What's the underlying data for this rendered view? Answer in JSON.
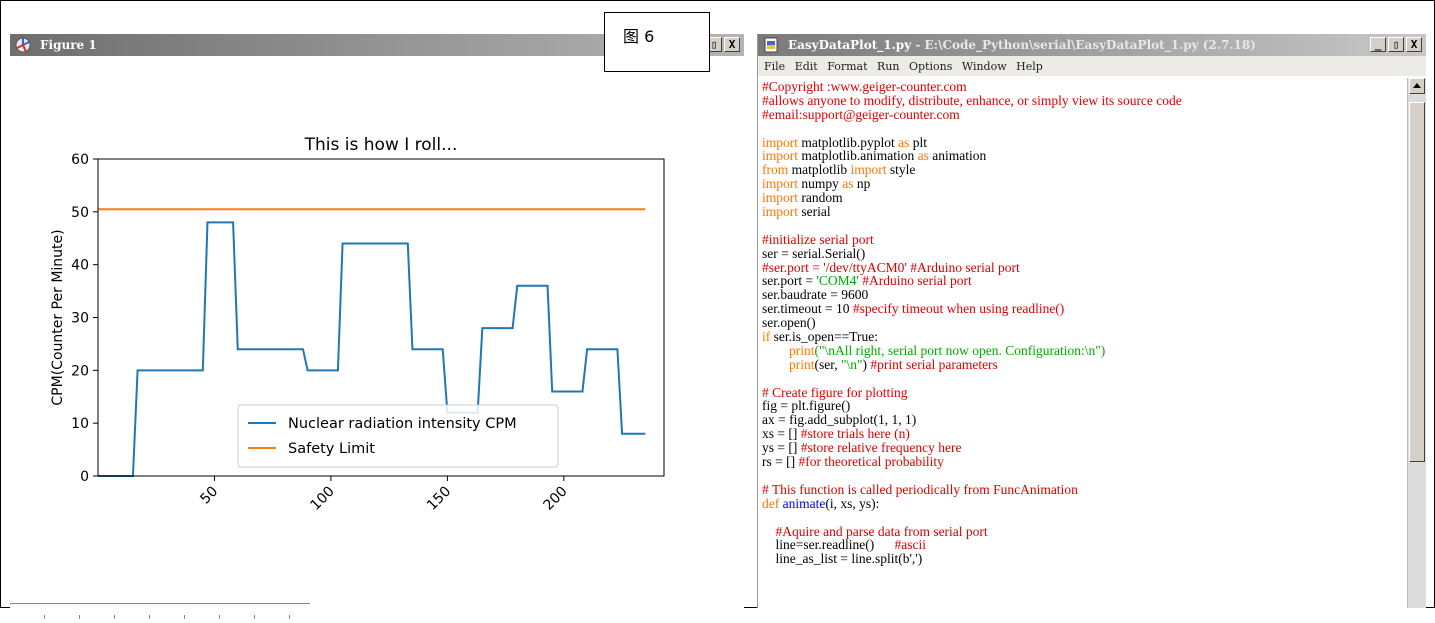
{
  "figure_window": {
    "title": "Figure 1",
    "buttons": [
      "▯",
      "X"
    ]
  },
  "label_box": {
    "text": "图 6"
  },
  "chart_data": {
    "type": "line",
    "title": "This is how I roll...",
    "xlabel": "",
    "ylabel": "CPM(Counter Per Minute)",
    "xlim": [
      0,
      243
    ],
    "ylim": [
      0,
      60
    ],
    "xticks": [
      50,
      100,
      150,
      200
    ],
    "yticks": [
      0,
      10,
      20,
      30,
      40,
      50,
      60
    ],
    "grid": false,
    "legend_position": "lower-center",
    "series": [
      {
        "name": "Nuclear radiation intensity CPM",
        "color": "#1f77b4",
        "x": [
          0,
          15,
          17,
          45,
          47,
          58,
          60,
          88,
          90,
          103,
          105,
          133,
          135,
          148,
          150,
          163,
          165,
          178,
          180,
          193,
          195,
          208,
          210,
          223,
          225,
          235
        ],
        "y": [
          0,
          0,
          20,
          20,
          48,
          48,
          24,
          24,
          20,
          20,
          44,
          44,
          24,
          24,
          12,
          12,
          28,
          28,
          36,
          36,
          16,
          16,
          24,
          24,
          8,
          8
        ]
      },
      {
        "name": " Safety Limit",
        "color": "#ff7f0e",
        "x": [
          0,
          235
        ],
        "y": [
          50.5,
          50.5
        ]
      }
    ]
  },
  "editor": {
    "title_file": "EasyDataPlot_1.py",
    "title_rest": " - E:\\Code_Python\\serial\\EasyDataPlot_1.py (2.7.18)",
    "buttons": [
      "_",
      "▯",
      "X"
    ],
    "menu": [
      "File",
      "Edit",
      "Format",
      "Run",
      "Options",
      "Window",
      "Help"
    ],
    "code_lines": [
      [
        [
          "c",
          "#Copyright :www.geiger-counter.com"
        ]
      ],
      [
        [
          "c",
          "#allows anyone to modify, distribute, enhance, or simply view its source code"
        ]
      ],
      [
        [
          "c",
          "#email:support@geiger-counter.com"
        ]
      ],
      [
        [
          "",
          ""
        ]
      ],
      [
        [
          "k",
          "import"
        ],
        [
          "",
          " matplotlib.pyplot "
        ],
        [
          "k",
          "as"
        ],
        [
          "",
          " plt"
        ]
      ],
      [
        [
          "k",
          "import"
        ],
        [
          "",
          " matplotlib.animation "
        ],
        [
          "k",
          "as"
        ],
        [
          "",
          " animation"
        ]
      ],
      [
        [
          "k",
          "from"
        ],
        [
          "",
          " matplotlib "
        ],
        [
          "k",
          "import"
        ],
        [
          "",
          " style"
        ]
      ],
      [
        [
          "k",
          "import"
        ],
        [
          "",
          " numpy "
        ],
        [
          "k",
          "as"
        ],
        [
          "",
          " np"
        ]
      ],
      [
        [
          "k",
          "import"
        ],
        [
          "",
          " random"
        ]
      ],
      [
        [
          "k",
          "import"
        ],
        [
          "",
          " serial"
        ]
      ],
      [
        [
          "",
          ""
        ]
      ],
      [
        [
          "c",
          "#initialize serial port"
        ]
      ],
      [
        [
          "",
          "ser = serial.Serial()"
        ]
      ],
      [
        [
          "c",
          "#ser.port = '/dev/ttyACM0' #Arduino serial port"
        ]
      ],
      [
        [
          "",
          "ser.port = "
        ],
        [
          "s",
          "'COM4'"
        ],
        [
          "c",
          " #Arduino serial port"
        ]
      ],
      [
        [
          "",
          "ser.baudrate = 9600"
        ]
      ],
      [
        [
          "",
          "ser.timeout = 10 "
        ],
        [
          "c",
          "#specify timeout when using readline()"
        ]
      ],
      [
        [
          "",
          "ser.open()"
        ]
      ],
      [
        [
          "k",
          "if"
        ],
        [
          "",
          " ser.is_open==True:"
        ]
      ],
      [
        [
          "",
          "        "
        ],
        [
          "k",
          "print"
        ],
        [
          "s",
          "(\"\\nAll right, serial port now open. Configuration:\\n\")"
        ]
      ],
      [
        [
          "",
          "        "
        ],
        [
          "k",
          "print"
        ],
        [
          "",
          "(ser, "
        ],
        [
          "s",
          "\"\\n\""
        ],
        [
          "",
          ") "
        ],
        [
          "c",
          "#print serial parameters"
        ]
      ],
      [
        [
          "",
          ""
        ]
      ],
      [
        [
          "c",
          "# Create figure for plotting"
        ]
      ],
      [
        [
          "",
          "fig = plt.figure()"
        ]
      ],
      [
        [
          "",
          "ax = fig.add_subplot(1, 1, 1)"
        ]
      ],
      [
        [
          "",
          "xs = [] "
        ],
        [
          "c",
          "#store trials here (n)"
        ]
      ],
      [
        [
          "",
          "ys = [] "
        ],
        [
          "c",
          "#store relative frequency here"
        ]
      ],
      [
        [
          "",
          "rs = [] "
        ],
        [
          "c",
          "#for theoretical probability"
        ]
      ],
      [
        [
          "",
          ""
        ]
      ],
      [
        [
          "c",
          "# This function is called periodically from FuncAnimation"
        ]
      ],
      [
        [
          "k",
          "def"
        ],
        [
          "",
          " "
        ],
        [
          "f",
          "animate"
        ],
        [
          "",
          "(i, xs, ys):"
        ]
      ],
      [
        [
          "",
          ""
        ]
      ],
      [
        [
          "",
          "    "
        ],
        [
          "c",
          "#Aquire and parse data from serial port"
        ]
      ],
      [
        [
          "",
          "    line=ser.readline()      "
        ],
        [
          "c",
          "#ascii"
        ]
      ],
      [
        [
          "",
          "    line_as_list = line.split(b',')"
        ]
      ]
    ]
  }
}
